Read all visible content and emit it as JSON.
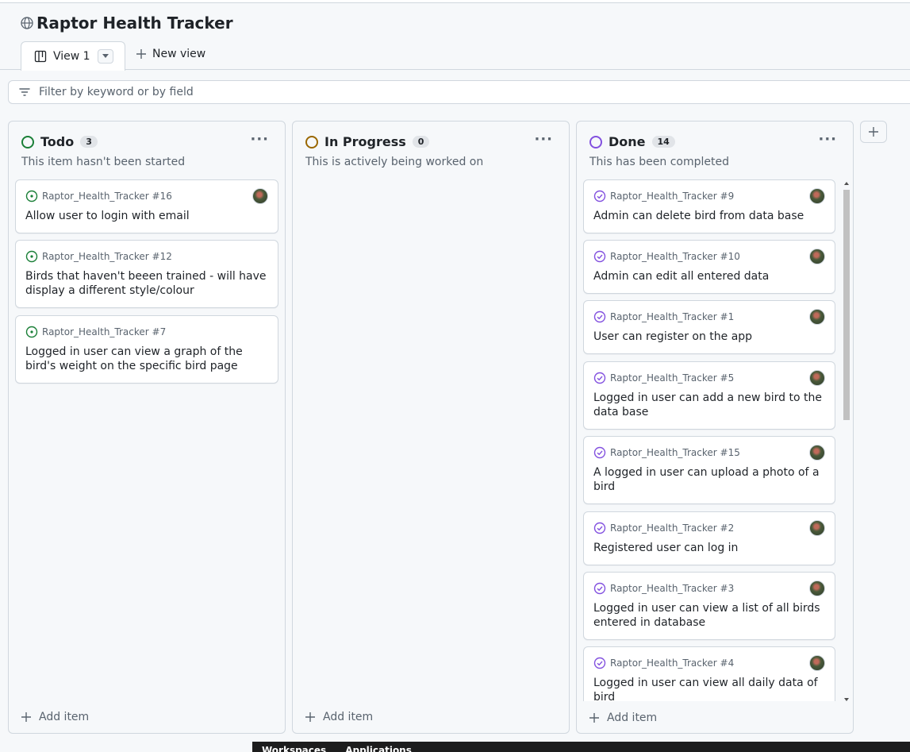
{
  "project": {
    "title": "Raptor Health Tracker"
  },
  "tabs": {
    "active_label": "View 1",
    "new_view_label": "New view"
  },
  "filter": {
    "placeholder": "Filter by keyword or by field"
  },
  "columns": [
    {
      "name": "Todo",
      "count": "3",
      "description": "This item hasn't been started",
      "status_color": "#1a7f37",
      "cards": [
        {
          "ref": "Raptor_Health_Tracker #16",
          "title": "Allow user to login with email"
        },
        {
          "ref": "Raptor_Health_Tracker #12",
          "title": "Birds that haven't beeen trained - will have display a different style/colour"
        },
        {
          "ref": "Raptor_Health_Tracker #7",
          "title": "Logged in user can view a graph of the bird's weight on the specific bird page"
        }
      ],
      "add_label": "Add item"
    },
    {
      "name": "In Progress",
      "count": "0",
      "description": "This is actively being worked on",
      "status_color": "#9a6700",
      "cards": [],
      "add_label": "Add item"
    },
    {
      "name": "Done",
      "count": "14",
      "description": "This has been completed",
      "status_color": "#8250df",
      "cards": [
        {
          "ref": "Raptor_Health_Tracker #9",
          "title": "Admin can delete bird from data base"
        },
        {
          "ref": "Raptor_Health_Tracker #10",
          "title": "Admin can edit all entered data"
        },
        {
          "ref": "Raptor_Health_Tracker #1",
          "title": "User can register on the app"
        },
        {
          "ref": "Raptor_Health_Tracker #5",
          "title": "Logged in user can add a new bird to the data base"
        },
        {
          "ref": "Raptor_Health_Tracker #15",
          "title": "A logged in user can upload a photo of a bird"
        },
        {
          "ref": "Raptor_Health_Tracker #2",
          "title": "Registered user can log in"
        },
        {
          "ref": "Raptor_Health_Tracker #3",
          "title": "Logged in user can view a list of all birds entered in database"
        },
        {
          "ref": "Raptor_Health_Tracker #4",
          "title": "Logged in user can view all daily data of bird"
        }
      ],
      "add_label": "Add item"
    }
  ],
  "taskbar": {
    "items": [
      "Workspaces",
      "Applications"
    ]
  },
  "colors": {
    "todo": "#1a7f37",
    "in_progress": "#9a6700",
    "done": "#8250df",
    "border": "#d0d7de"
  },
  "icons": {
    "project": "globe-icon",
    "board": "board-icon",
    "filter": "filter-icon",
    "more": "kebab-horizontal-icon",
    "open_issue": "issue-opened-icon",
    "closed_issue": "issue-closed-icon"
  }
}
